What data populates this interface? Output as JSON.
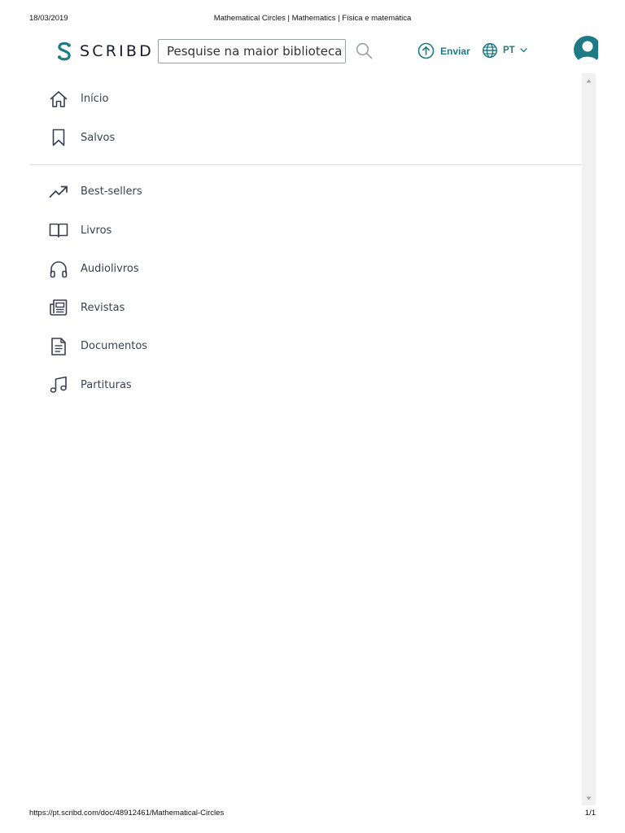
{
  "print": {
    "date": "18/03/2019",
    "title": "Mathematical Circles | Mathematics | Física e matemática",
    "url": "https://pt.scribd.com/doc/48912461/Mathematical-Circles",
    "page": "1/1"
  },
  "header": {
    "logo_text": "SCRIBD",
    "search_placeholder": "Pesquise na maior biblioteca do",
    "upload_label": "Enviar",
    "language_label": "PT"
  },
  "menu": {
    "primary": [
      {
        "label": "Início",
        "icon": "home-icon"
      },
      {
        "label": "Salvos",
        "icon": "bookmark-icon"
      }
    ],
    "secondary": [
      {
        "label": "Best-sellers",
        "icon": "trending-icon"
      },
      {
        "label": "Livros",
        "icon": "book-icon"
      },
      {
        "label": "Audiolivros",
        "icon": "headphones-icon"
      },
      {
        "label": "Revistas",
        "icon": "newspaper-icon"
      },
      {
        "label": "Documentos",
        "icon": "document-icon"
      },
      {
        "label": "Partituras",
        "icon": "music-note-icon"
      }
    ]
  },
  "colors": {
    "accent": "#1e7b85",
    "text": "#3b3f52",
    "icon": "#3b3f52"
  }
}
